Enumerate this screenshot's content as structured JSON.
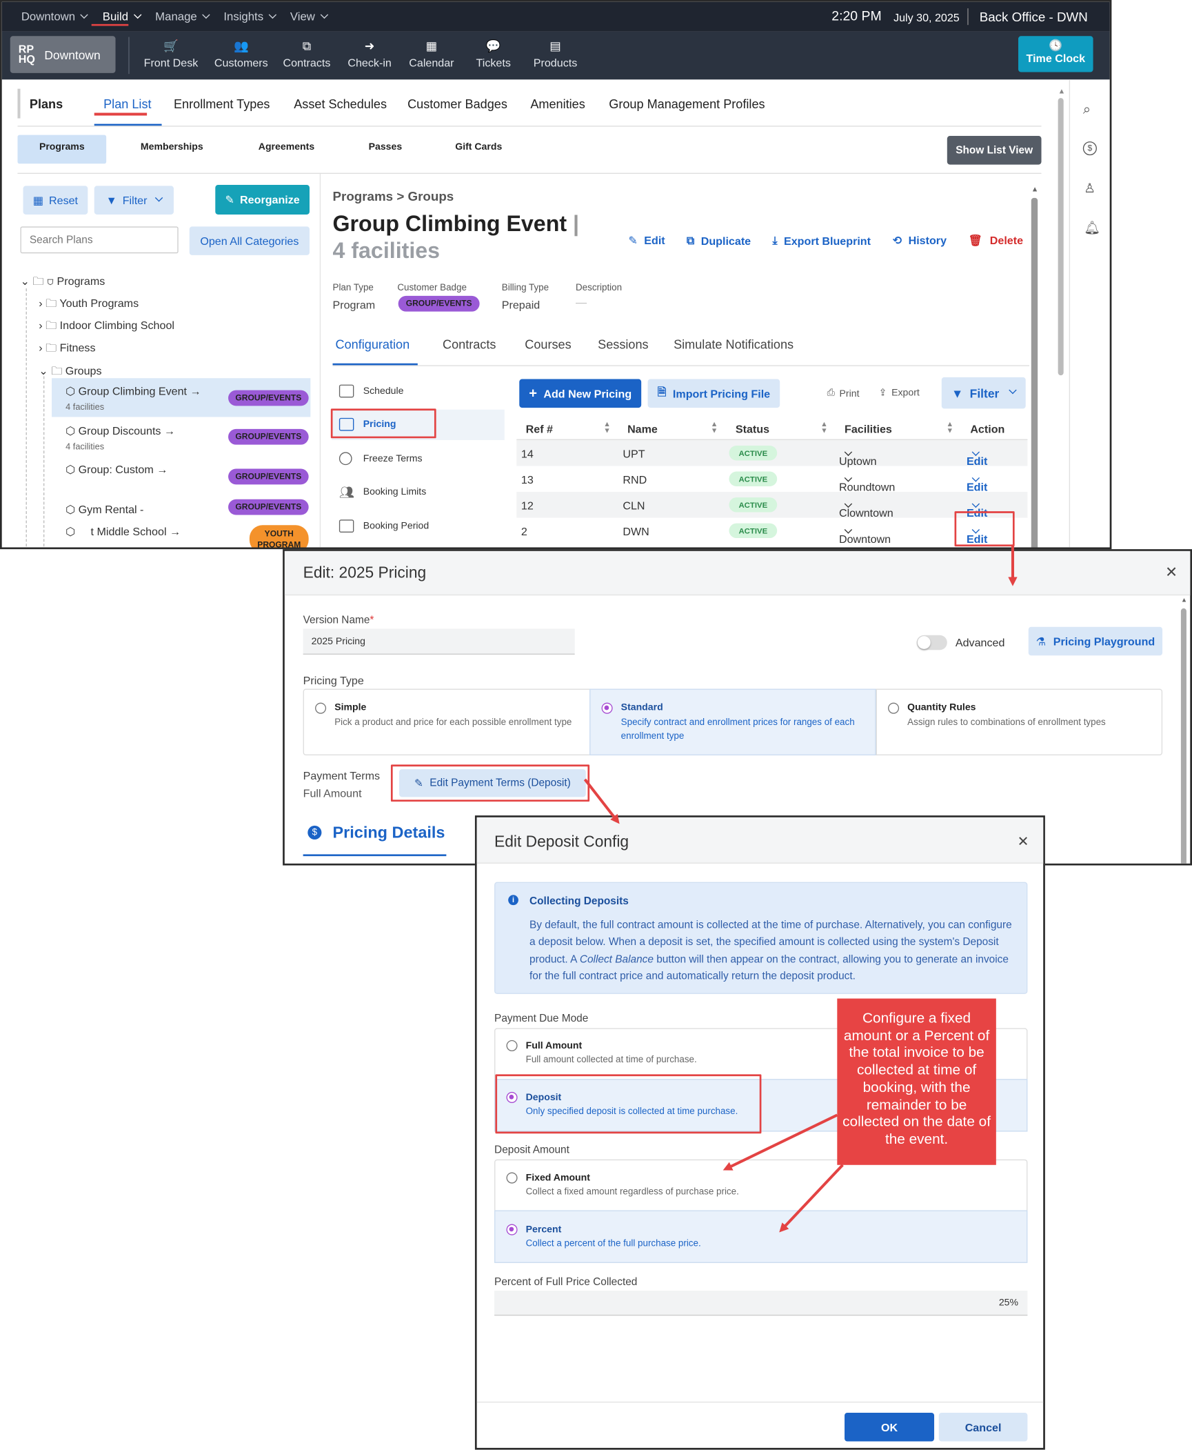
{
  "topbar": {
    "location": "Downtown",
    "menus": [
      "Build",
      "Manage",
      "Insights",
      "View"
    ],
    "time": "2:20 PM",
    "date": "July 30, 2025",
    "office": "Back Office - DWN"
  },
  "navbar": {
    "logo": "RP\nHQ",
    "location": "Downtown",
    "items": [
      "Front Desk",
      "Customers",
      "Contracts",
      "Check-in",
      "Calendar",
      "Tickets",
      "Products"
    ],
    "time_clock": "Time Clock"
  },
  "plans_tabs": {
    "title": "Plans",
    "tabs": [
      "Plan List",
      "Enrollment Types",
      "Asset Schedules",
      "Customer Badges",
      "Amenities",
      "Group Management Profiles"
    ]
  },
  "sub_tabs": [
    "Programs",
    "Memberships",
    "Agreements",
    "Passes",
    "Gift Cards"
  ],
  "show_list_view": "Show List View",
  "left": {
    "reset": "Reset",
    "filter": "Filter",
    "reorganize": "Reorganize",
    "search_placeholder": "Search Plans",
    "open_all": "Open All Categories",
    "tree": {
      "root": "Programs",
      "cats": [
        "Youth Programs",
        "Indoor Climbing School",
        "Fitness",
        "Groups"
      ],
      "items": [
        {
          "name": "Group Climbing Event →",
          "sub": "4 facilities",
          "badge": "GROUP/EVENTS"
        },
        {
          "name": "Group Discounts →",
          "sub": "4 facilities",
          "badge": "GROUP/EVENTS"
        },
        {
          "name": "Group: Custom →",
          "badge": "GROUP/EVENTS"
        },
        {
          "name": "Gym Rental -",
          "badge": "GROUP/EVENTS"
        },
        {
          "name": "t Middle School →",
          "badge": "YOUTH PROGRAM"
        }
      ]
    }
  },
  "detail": {
    "breadcrumb": "Programs > Groups",
    "title": "Group Climbing Event",
    "title_sep": "|",
    "subtitle": "4 facilities",
    "actions": [
      "Edit",
      "Duplicate",
      "Export Blueprint",
      "History",
      "Delete"
    ],
    "plan_type_label": "Plan Type",
    "plan_type": "Program",
    "badge_label": "Customer Badge",
    "badge": "GROUP/EVENTS",
    "billing_label": "Billing Type",
    "billing": "Prepaid",
    "desc_label": "Description",
    "desc": "—",
    "tabs": [
      "Configuration",
      "Contracts",
      "Courses",
      "Sessions",
      "Simulate Notifications"
    ],
    "side_menu": [
      "Schedule",
      "Pricing",
      "Freeze Terms",
      "Booking Limits",
      "Booking Period"
    ],
    "add_pricing": "Add New Pricing",
    "import_pricing": "Import Pricing File",
    "print": "Print",
    "export": "Export",
    "filter": "Filter",
    "columns": [
      "Ref #",
      "Name",
      "Status",
      "Facilities",
      "Action"
    ],
    "rows": [
      {
        "ref": "14",
        "name": "UPT",
        "status": "ACTIVE",
        "facility": "Uptown",
        "action": "Edit"
      },
      {
        "ref": "13",
        "name": "RND",
        "status": "ACTIVE",
        "facility": "Roundtown",
        "action": "Edit"
      },
      {
        "ref": "12",
        "name": "CLN",
        "status": "ACTIVE",
        "facility": "Clowntown",
        "action": "Edit"
      },
      {
        "ref": "2",
        "name": "DWN",
        "status": "ACTIVE",
        "facility": "Downtown",
        "action": "Edit"
      }
    ]
  },
  "edit_pricing": {
    "title": "Edit: 2025 Pricing",
    "version_label": "Version Name",
    "version_value": "2025 Pricing",
    "advanced": "Advanced",
    "playground": "Pricing Playground",
    "pricing_type_label": "Pricing Type",
    "types": [
      {
        "title": "Simple",
        "desc": "Pick a product and price for each possible enrollment type"
      },
      {
        "title": "Standard",
        "desc": "Specify contract and enrollment prices for ranges of each enrollment type"
      },
      {
        "title": "Quantity Rules",
        "desc": "Assign rules to combinations of enrollment types"
      }
    ],
    "payment_terms_label": "Payment Terms",
    "payment_terms_value": "Full Amount",
    "edit_terms": "Edit Payment Terms (Deposit)",
    "pricing_details": "Pricing Details"
  },
  "deposit": {
    "title": "Edit Deposit Config",
    "info_title": "Collecting Deposits",
    "info_p1": "By default, the full contract amount is collected at the time of purchase. Alternatively, you can configure a deposit below. When a deposit is set, the specified amount is collected using the system's Deposit product. A ",
    "info_em": "Collect Balance",
    "info_p2": " button will then appear on the contract, allowing you to generate an invoice for the full contract price and automatically return the deposit product.",
    "mode_label": "Payment Due Mode",
    "modes": [
      {
        "title": "Full Amount",
        "desc": "Full amount collected at time of purchase."
      },
      {
        "title": "Deposit",
        "desc": "Only specified deposit is collected at time purchase."
      }
    ],
    "amount_label": "Deposit Amount",
    "amounts": [
      {
        "title": "Fixed Amount",
        "desc": "Collect a fixed amount regardless of purchase price."
      },
      {
        "title": "Percent",
        "desc": "Collect a percent of the full purchase price."
      }
    ],
    "percent_label": "Percent of Full Price Collected",
    "percent_value": "25%",
    "ok": "OK",
    "cancel": "Cancel"
  },
  "callout": "Configure a fixed amount or a Percent of the total invoice to be collected at time of booking, with the remainder to be collected on the date of the event."
}
